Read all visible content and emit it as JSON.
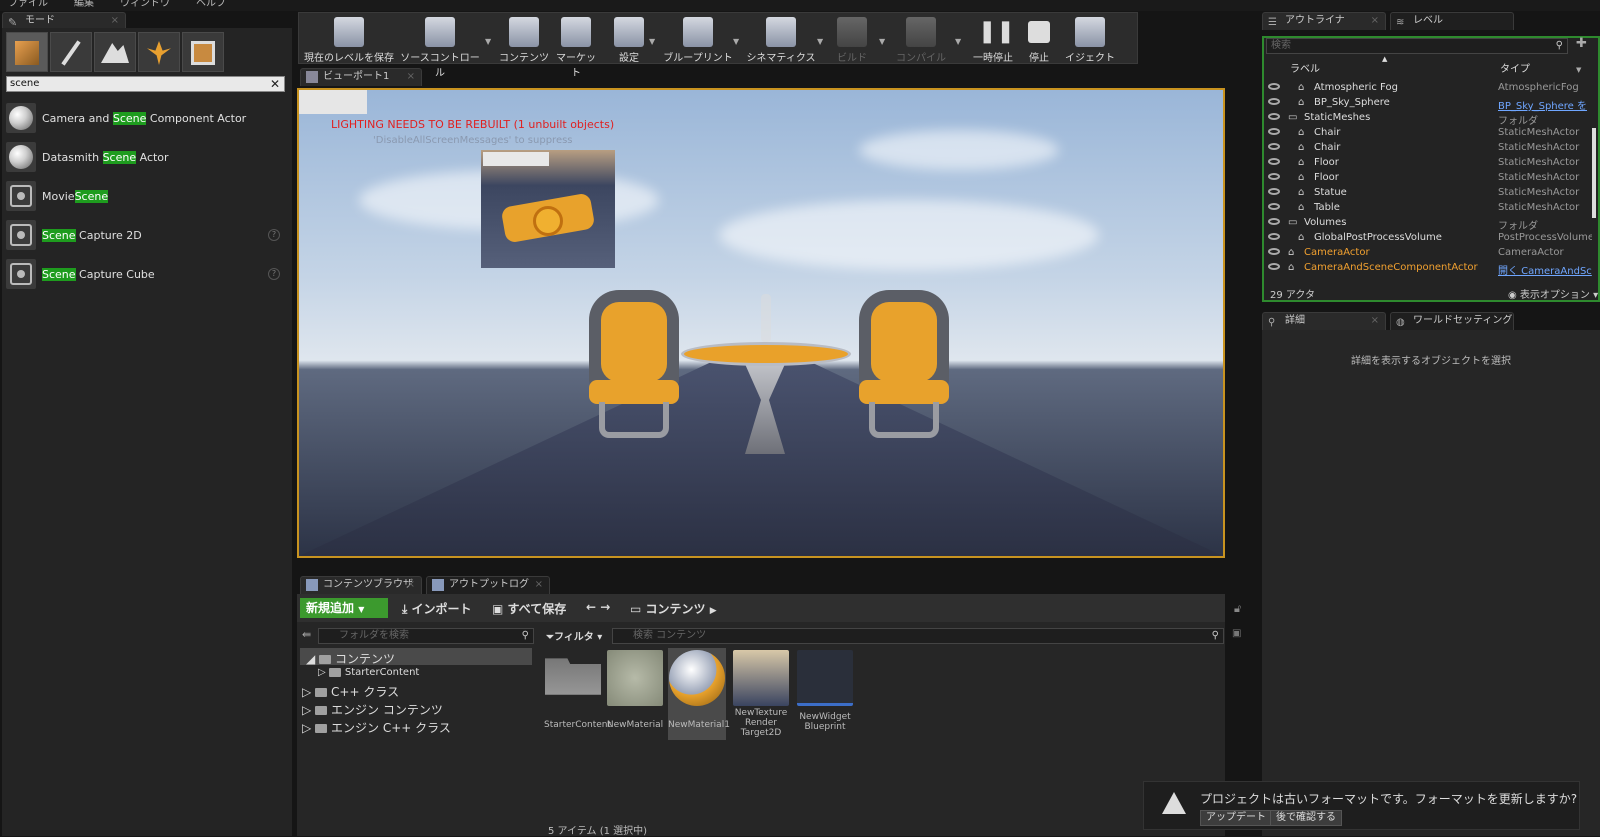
{
  "menu": [
    "ファイル",
    "編集",
    "ウィンドウ",
    "ヘルプ"
  ],
  "modes": {
    "tab_label": "モード",
    "search_value": "scene",
    "items": [
      {
        "pre": "Camera and ",
        "hl": "Scene",
        "post": " Component Actor"
      },
      {
        "pre": "Datasmith ",
        "hl": "Scene",
        "post": " Actor"
      },
      {
        "pre": "Movie",
        "hl": "Scene",
        "post": ""
      },
      {
        "pre": "",
        "hl": "Scene",
        "post": " Capture 2D"
      },
      {
        "pre": "",
        "hl": "Scene",
        "post": " Capture Cube"
      }
    ]
  },
  "toolbar": {
    "save": "現在のレベルを保存",
    "source": "ソースコントロール",
    "content": "コンテンツ",
    "market": "マーケット",
    "settings": "設定",
    "blueprint": "ブループリント",
    "cinematics": "シネマティクス",
    "build": "ビルド",
    "compile": "コンパイル",
    "pause": "一時停止",
    "stop": "停止",
    "eject": "イジェクト"
  },
  "viewport": {
    "tab_label": "ビューポート1",
    "warning": "LIGHTING NEEDS TO BE REBUILT (1 unbuilt objects)",
    "warning_sub": "'DisableAllScreenMessages' to suppress"
  },
  "content_browser": {
    "tab_label": "コンテンツブラウザ",
    "output_tab": "アウトプットログ",
    "add_new": "新規追加",
    "import": "インポート",
    "save_all": "すべて保存",
    "path": "コンテンツ",
    "folder_search_placeholder": "フォルダを検索",
    "filter": "フィルタ",
    "content_search_placeholder": "検索 コンテンツ",
    "tree": [
      "コンテンツ",
      "StarterContent",
      "C++ クラス",
      "エンジン コンテンツ",
      "エンジン C++ クラス"
    ],
    "assets": [
      "StarterContent",
      "NewMaterial",
      "NewMaterial1",
      "NewTexture Render Target2D",
      "NewWidget Blueprint"
    ],
    "status": "5 アイテム (1 選択中)"
  },
  "outliner": {
    "tab_label": "アウトライナ",
    "level_tab": "レベル",
    "search_placeholder": "検索",
    "col_label": "ラベル",
    "col_type": "タイプ",
    "rows": [
      {
        "name": "Atmospheric Fog",
        "type": "AtmosphericFog",
        "link": false,
        "orange": false
      },
      {
        "name": "BP_Sky_Sphere",
        "type": "BP_Sky_Sphere を",
        "link": true,
        "orange": false
      },
      {
        "name": "StaticMeshes",
        "type": "フォルダ",
        "link": false,
        "orange": false
      },
      {
        "name": "Chair",
        "type": "StaticMeshActor",
        "link": false,
        "orange": false
      },
      {
        "name": "Chair",
        "type": "StaticMeshActor",
        "link": false,
        "orange": false
      },
      {
        "name": "Floor",
        "type": "StaticMeshActor",
        "link": false,
        "orange": false
      },
      {
        "name": "Floor",
        "type": "StaticMeshActor",
        "link": false,
        "orange": false
      },
      {
        "name": "Statue",
        "type": "StaticMeshActor",
        "link": false,
        "orange": false
      },
      {
        "name": "Table",
        "type": "StaticMeshActor",
        "link": false,
        "orange": false
      },
      {
        "name": "Volumes",
        "type": "フォルダ",
        "link": false,
        "orange": false
      },
      {
        "name": "GlobalPostProcessVolume",
        "type": "PostProcessVolume",
        "link": false,
        "orange": false
      },
      {
        "name": "CameraActor",
        "type": "CameraActor",
        "link": false,
        "orange": true
      },
      {
        "name": "CameraAndSceneComponentActor",
        "type": "開く CameraAndSc",
        "link": true,
        "orange": true
      }
    ],
    "count": "29 アクタ",
    "view_options": "表示オプション"
  },
  "details": {
    "tab_label": "詳細",
    "world_tab": "ワールドセッティング",
    "placeholder": "詳細を表示するオブジェクトを選択"
  },
  "notification": {
    "message": "プロジェクトは古いフォーマットです。フォーマットを更新しますか?",
    "update": "アップデート",
    "later": "後で確認する"
  }
}
